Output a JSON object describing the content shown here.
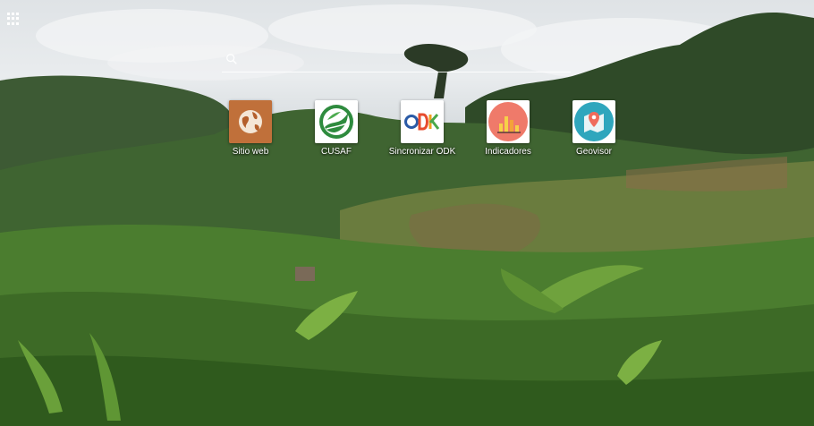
{
  "home": {
    "apps_icon": "apps-grid-icon",
    "search_icon": "search-icon",
    "shortcuts": [
      {
        "label": "Sitio web",
        "icon": "globe-icon",
        "color": "#c0703a"
      },
      {
        "label": "CUSAF",
        "icon": "cusaf-logo-icon",
        "color": "#ffffff"
      },
      {
        "label": "Sincronizar ODK",
        "icon": "odk-logo-icon",
        "color": "#ffffff"
      },
      {
        "label": "Indicadores",
        "icon": "bar-chart-icon",
        "color": "#ef7a6a"
      },
      {
        "label": "Geovisor",
        "icon": "map-pin-icon",
        "color": "#2fa6bd"
      }
    ]
  }
}
